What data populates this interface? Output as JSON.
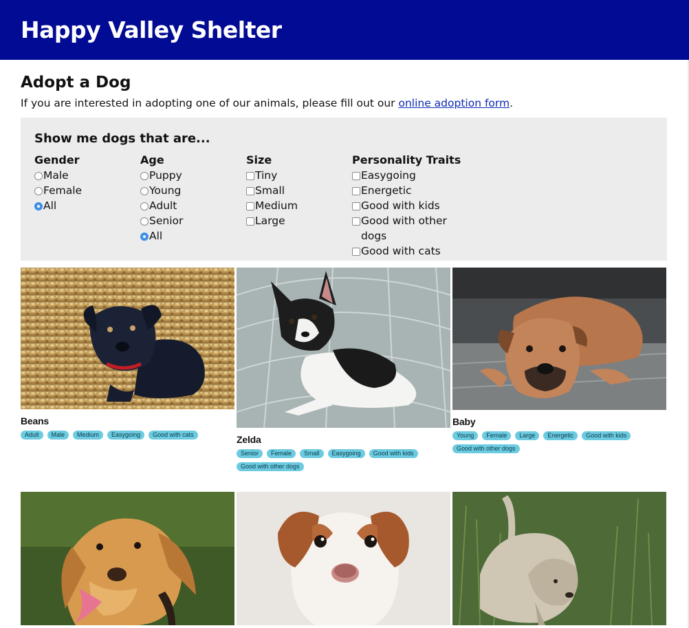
{
  "header": {
    "title": "Happy Valley Shelter"
  },
  "main": {
    "title": "Adopt a Dog",
    "intro_before": "If you are interested in adopting one of our animals, please fill out our ",
    "intro_link": "online adoption form",
    "intro_after": "."
  },
  "filters": {
    "heading": "Show me dogs that are...",
    "gender": {
      "label": "Gender",
      "options": [
        "Male",
        "Female",
        "All"
      ],
      "selected": "All"
    },
    "age": {
      "label": "Age",
      "options": [
        "Puppy",
        "Young",
        "Adult",
        "Senior",
        "All"
      ],
      "selected": "All"
    },
    "size": {
      "label": "Size",
      "options": [
        "Tiny",
        "Small",
        "Medium",
        "Large"
      ]
    },
    "traits": {
      "label": "Personality Traits",
      "options": [
        "Easygoing",
        "Energetic",
        "Good with kids",
        "Good with other dogs",
        "Good with cats"
      ]
    }
  },
  "dogs": [
    {
      "name": "Beans",
      "tags": [
        "Adult",
        "Male",
        "Medium",
        "Easygoing",
        "Good with cats"
      ]
    },
    {
      "name": "Zelda",
      "tags": [
        "Senior",
        "Female",
        "Small",
        "Easygoing",
        "Good with kids",
        "Good with other dogs"
      ]
    },
    {
      "name": "Baby",
      "tags": [
        "Young",
        "Female",
        "Large",
        "Energetic",
        "Good with kids",
        "Good with other dogs"
      ]
    },
    {
      "name": "",
      "tags": []
    },
    {
      "name": "",
      "tags": []
    },
    {
      "name": "",
      "tags": []
    }
  ],
  "colors": {
    "header_bg": "#020b93",
    "filter_bg": "#ececec",
    "tag_bg": "#6ccbe0",
    "radio_selected": "#3d8fe8"
  }
}
